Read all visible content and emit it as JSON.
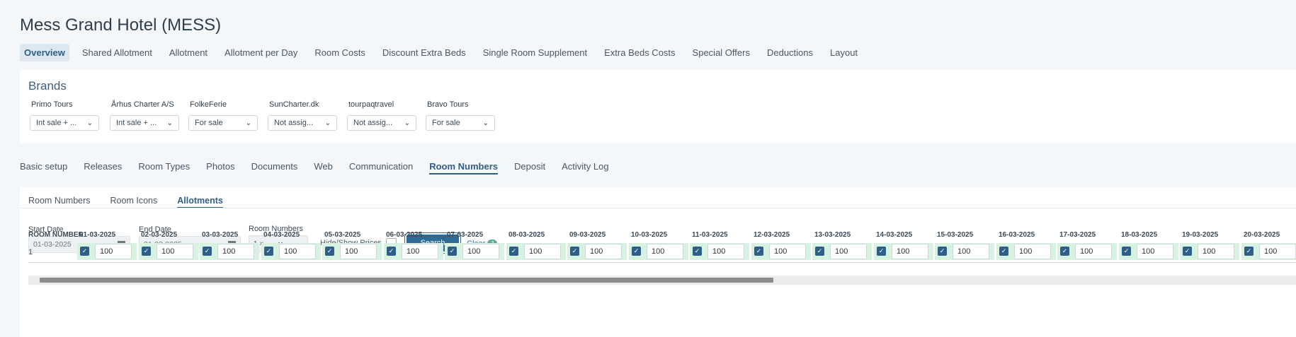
{
  "title": "Mess Grand Hotel (MESS)",
  "top_nav": [
    "Overview",
    "Shared Allotment",
    "Allotment",
    "Allotment per Day",
    "Room Costs",
    "Discount Extra Beds",
    "Single Room Supplement",
    "Extra Beds Costs",
    "Special Offers",
    "Deductions",
    "Layout"
  ],
  "brands": {
    "heading": "Brands",
    "items": [
      {
        "name": "Primo Tours",
        "value": "Int sale + ..."
      },
      {
        "name": "Århus Charter A/S",
        "value": "Int sale + ..."
      },
      {
        "name": "FolkeFerie",
        "value": "For sale"
      },
      {
        "name": "SunCharter.dk",
        "value": "Not assig..."
      },
      {
        "name": "tourpaqtravel",
        "value": "Not assig..."
      },
      {
        "name": "Bravo Tours",
        "value": "For sale"
      }
    ]
  },
  "section_tabs": [
    "Basic setup",
    "Releases",
    "Room Types",
    "Photos",
    "Documents",
    "Web",
    "Communication",
    "Room Numbers",
    "Deposit",
    "Activity Log"
  ],
  "sub_tabs": [
    "Room Numbers",
    "Room Icons",
    "Allotments"
  ],
  "filters": {
    "start_label": "Start Date",
    "start_value": "01-03-2025",
    "end_label": "End Date",
    "end_value": "31-03-2025",
    "room_label": "Room Numbers",
    "room_chip": "1",
    "hide_prices": "Hide/Show Prices",
    "search": "Search",
    "clear": "Clear",
    "clear_count": "3"
  },
  "grid": {
    "row_header": "ROOM NUMBER",
    "dates": [
      "01-03-2025",
      "02-03-2025",
      "03-03-2025",
      "04-03-2025",
      "05-03-2025",
      "06-03-2025",
      "07-03-2025",
      "08-03-2025",
      "09-03-2025",
      "10-03-2025",
      "11-03-2025",
      "12-03-2025",
      "13-03-2025",
      "14-03-2025",
      "15-03-2025",
      "16-03-2025",
      "17-03-2025",
      "18-03-2025",
      "19-03-2025",
      "20-03-2025"
    ],
    "rows": [
      {
        "room": "1",
        "value": "100"
      }
    ]
  }
}
